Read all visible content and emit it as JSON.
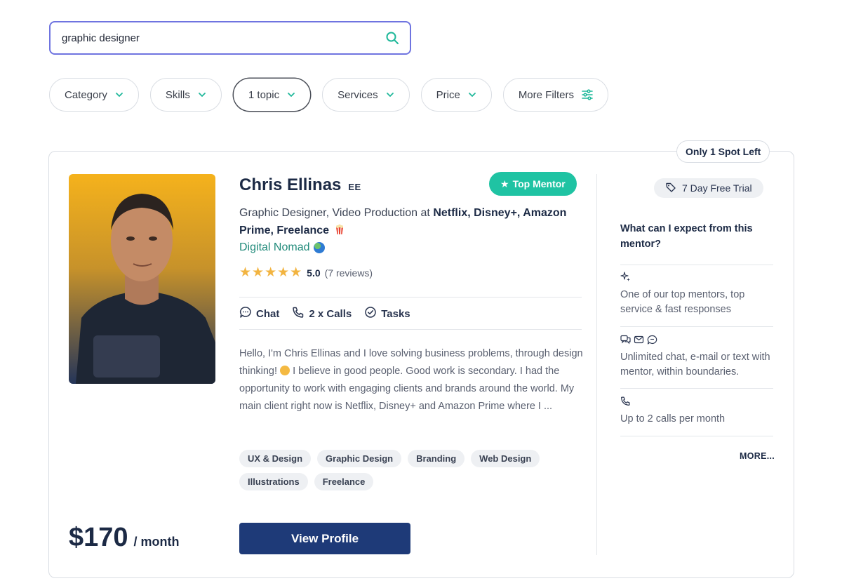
{
  "search": {
    "value": "graphic designer",
    "placeholder": ""
  },
  "filters": [
    {
      "label": "Category"
    },
    {
      "label": "Skills"
    },
    {
      "label": "1 topic"
    },
    {
      "label": "Services"
    },
    {
      "label": "Price"
    },
    {
      "label": "More Filters"
    }
  ],
  "mentor": {
    "spot_badge": "Only 1 Spot Left",
    "name": "Chris Ellinas",
    "country": "EE",
    "top_badge": "Top Mentor",
    "role_prefix": "Graphic Designer, Video Production at ",
    "role_companies": "Netflix, Disney+, Amazon Prime, Freelance",
    "location": "Digital Nomad",
    "rating": {
      "stars": 5,
      "score": "5.0",
      "reviews": "(7 reviews)"
    },
    "services": [
      "Chat",
      "2 x Calls",
      "Tasks"
    ],
    "bio_part1": "Hello, I'm Chris Ellinas and I love solving business problems, through design thinking! ",
    "bio_part2": " I believe in good people. Good work is secondary. I had the opportunity to work with engaging clients and brands around the world. My main client right now is Netflix, Disney+ and Amazon Prime where I ...",
    "tags": [
      "UX & Design",
      "Graphic Design",
      "Branding",
      "Web Design",
      "Illustrations",
      "Freelance"
    ],
    "price": "$170",
    "price_unit": "/ month",
    "view_button": "View Profile"
  },
  "sidebar": {
    "trial": "7 Day Free Trial",
    "expect_heading": "What can I expect from this mentor?",
    "features": [
      {
        "icon": "sparkle-icon",
        "text": "One of our top mentors, top service & fast responses"
      },
      {
        "icon": "chat-mail-icons",
        "text": "Unlimited chat, e-mail or text with mentor, within boundaries."
      },
      {
        "icon": "phone-icon",
        "text": "Up to 2 calls per month"
      }
    ],
    "more": "MORE..."
  },
  "colors": {
    "accent": "#1fc3a3",
    "primary_button": "#1e3a78",
    "search_border": "#6f74e0",
    "link": "#208a7a"
  }
}
